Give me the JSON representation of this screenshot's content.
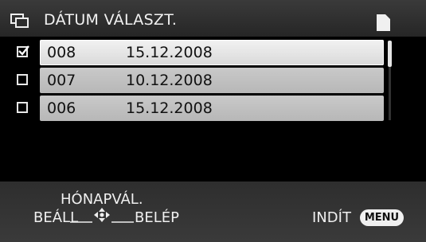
{
  "header": {
    "title": "DÁTUM VÁLASZT.",
    "left_icon": "multi-window-icon",
    "right_icon": "sd-card-icon"
  },
  "rows": [
    {
      "number": "008",
      "date": "15.12.2008",
      "checked": true,
      "selected": true
    },
    {
      "number": "007",
      "date": "10.12.2008",
      "checked": false,
      "selected": false
    },
    {
      "number": "006",
      "date": "15.12.2008",
      "checked": false,
      "selected": false
    }
  ],
  "footer": {
    "month_label": "HÓNAPVÁL.",
    "set_label": "BEÁLL",
    "enter_label": "BELÉP",
    "nav_icon": "dpad-nav-icon",
    "start_label": "INDÍT",
    "menu_button": "MENU"
  }
}
